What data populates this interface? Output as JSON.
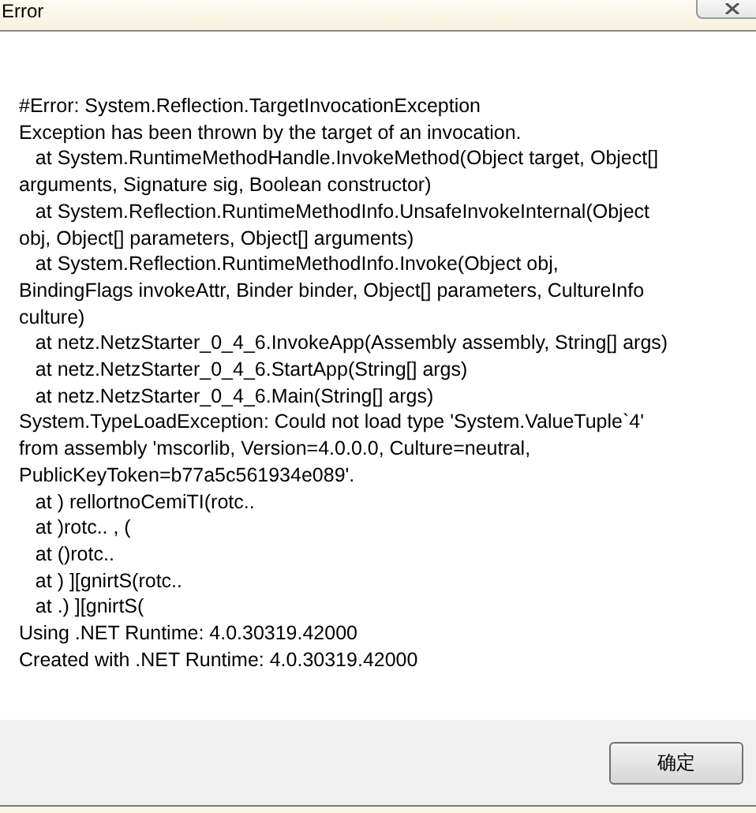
{
  "window": {
    "title": "Error"
  },
  "message_lines": [
    "#Error: System.Reflection.TargetInvocationException",
    "Exception has been thrown by the target of an invocation.",
    "   at System.RuntimeMethodHandle.InvokeMethod(Object target, Object[]",
    "arguments, Signature sig, Boolean constructor)",
    "   at System.Reflection.RuntimeMethodInfo.UnsafeInvokeInternal(Object",
    "obj, Object[] parameters, Object[] arguments)",
    "   at System.Reflection.RuntimeMethodInfo.Invoke(Object obj,",
    "BindingFlags invokeAttr, Binder binder, Object[] parameters, CultureInfo",
    "culture)",
    "   at netz.NetzStarter_0_4_6.InvokeApp(Assembly assembly, String[] args)",
    "   at netz.NetzStarter_0_4_6.StartApp(String[] args)",
    "   at netz.NetzStarter_0_4_6.Main(String[] args)",
    "System.TypeLoadException: Could not load type 'System.ValueTuple`4'",
    "from assembly 'mscorlib, Version=4.0.0.0, Culture=neutral,",
    "PublicKeyToken=b77a5c561934e089'.",
    "   at ) rellortnoCemiTI(rotc..",
    "   at )rotc.. , (",
    "   at ()rotc..",
    "   at ) ][gnirtS(rotc..",
    "   at .) ][gnirtS(",
    "Using .NET Runtime: 4.0.30319.42000",
    "Created with .NET Runtime: 4.0.30319.42000"
  ],
  "buttons": [
    {
      "label": "确定"
    }
  ]
}
